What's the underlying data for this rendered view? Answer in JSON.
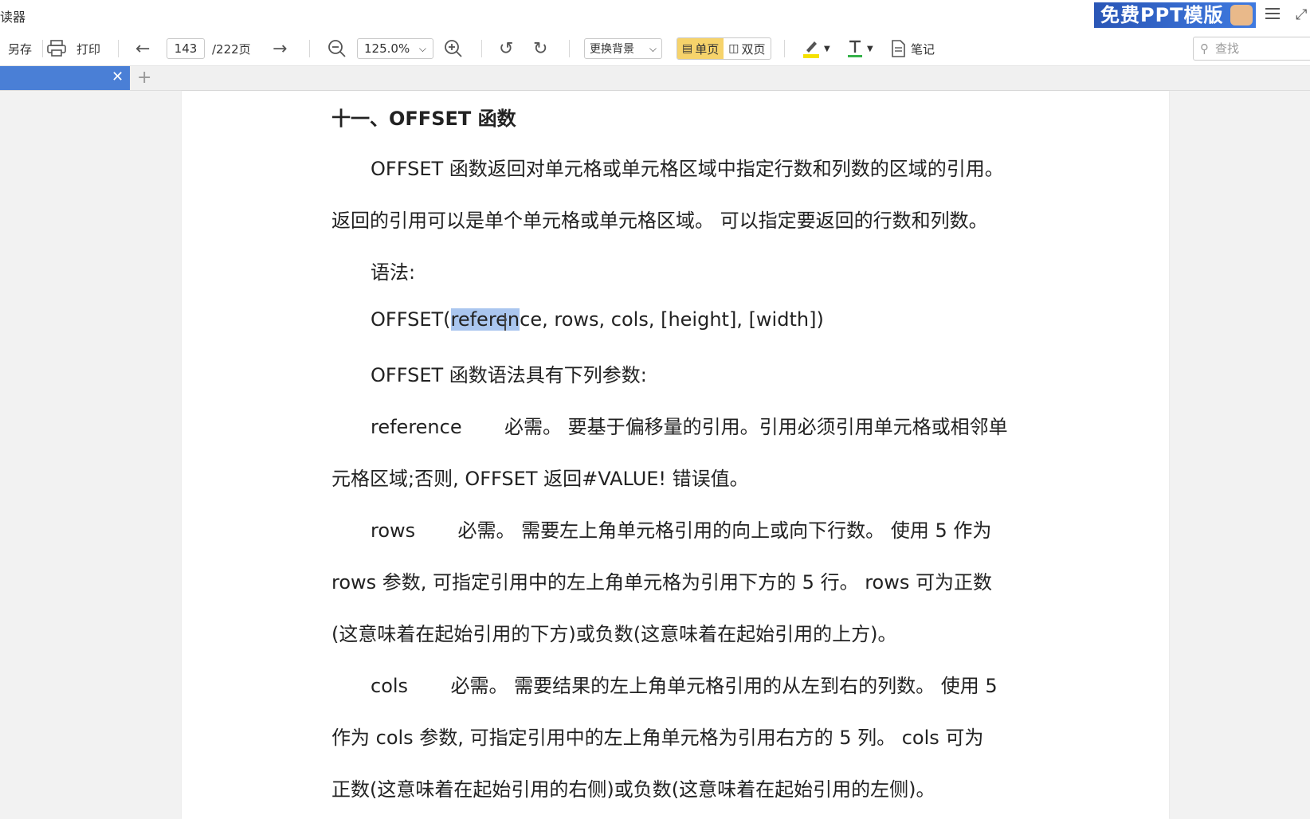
{
  "window": {
    "title": "读器"
  },
  "ad": {
    "text": "免费PPT模版"
  },
  "toolbar": {
    "save_as": "另存",
    "print": "打印",
    "page_current": "143",
    "page_total": "/222页",
    "zoom": "125.0%",
    "background": "更换背景",
    "single_page": "单页",
    "double_page": "双页",
    "note": "笔记",
    "search_placeholder": "查找"
  },
  "document": {
    "heading": "十一、OFFSET 函数",
    "p1_l1": "OFFSET 函数返回对单元格或单元格区域中指定行数和列数的区域的引用。",
    "p1_l2": "返回的引用可以是单个单元格或单元格区域。 可以指定要返回的行数和列数。",
    "syntax_label": "语法:",
    "syntax_pre": "OFFSET(",
    "syntax_selected": "referen",
    "syntax_post": "ce, rows, cols, [height], [width])",
    "params_intro": "OFFSET 函数语法具有下列参数:",
    "ref_l1": "reference       必需。 要基于偏移量的引用。引用必须引用单元格或相邻单",
    "ref_l2": "元格区域;否则, OFFSET 返回#VALUE! 错误值。",
    "rows_l1": "rows       必需。 需要左上角单元格引用的向上或向下行数。 使用 5 作为",
    "rows_l2": "rows 参数, 可指定引用中的左上角单元格为引用下方的 5 行。 rows 可为正数",
    "rows_l3": "(这意味着在起始引用的下方)或负数(这意味着在起始引用的上方)。",
    "cols_l1": "cols       必需。 需要结果的左上角单元格引用的从左到右的列数。 使用 5",
    "cols_l2": "作为 cols 参数, 可指定引用中的左上角单元格为引用右方的 5 列。 cols 可为",
    "cols_l3": "正数(这意味着在起始引用的右侧)或负数(这意味着在起始引用的左侧)。"
  }
}
